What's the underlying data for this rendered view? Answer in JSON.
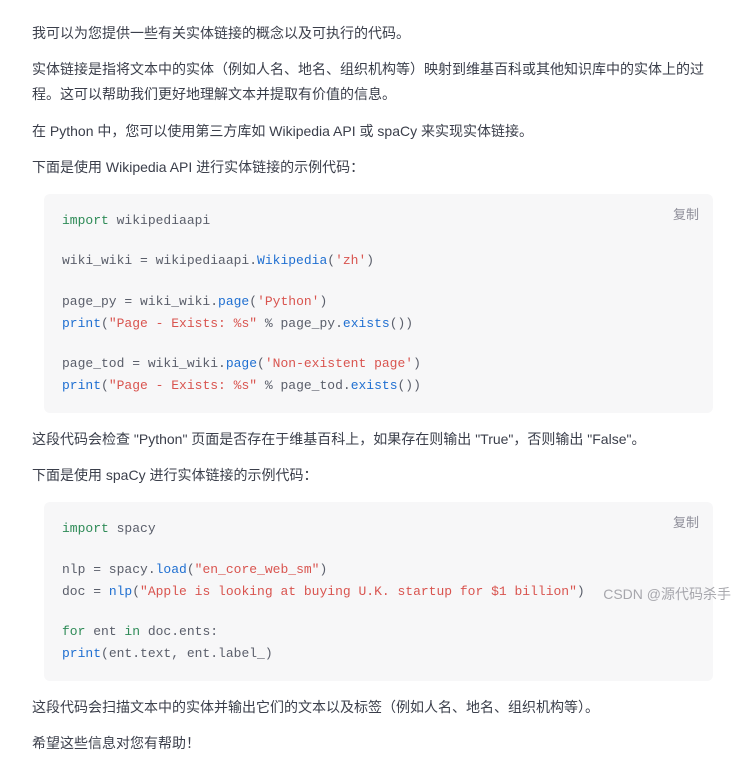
{
  "paragraphs": {
    "p1": "我可以为您提供一些有关实体链接的概念以及可执行的代码。",
    "p2": "实体链接是指将文本中的实体（例如人名、地名、组织机构等）映射到维基百科或其他知识库中的实体上的过程。这可以帮助我们更好地理解文本并提取有价值的信息。",
    "p3": "在 Python 中，您可以使用第三方库如 Wikipedia API 或 spaCy 来实现实体链接。",
    "p4": "下面是使用 Wikipedia API 进行实体链接的示例代码：",
    "p5": "这段代码会检查 \"Python\" 页面是否存在于维基百科上，如果存在则输出 \"True\"，否则输出 \"False\"。",
    "p6": "下面是使用 spaCy 进行实体链接的示例代码：",
    "p7": "这段代码会扫描文本中的实体并输出它们的文本以及标签（例如人名、地名、组织机构等）。",
    "p8": "希望这些信息对您有帮助！"
  },
  "copy_label": "复制",
  "code1": {
    "import_kw": "import",
    "module": " wikipediaapi",
    "l2_pre": "wiki_wiki = wikipediaapi.",
    "l2_fn": "Wikipedia",
    "l2_open": "(",
    "l2_str": "'zh'",
    "l2_close": ")",
    "l3_pre": "page_py = wiki_wiki.",
    "l3_fn": "page",
    "l3_open": "(",
    "l3_str": "'Python'",
    "l3_close": ")",
    "l4_fn": "print",
    "l4_open": "(",
    "l4_str": "\"Page - Exists: %s\"",
    "l4_mid": " % page_py.",
    "l4_fn2": "exists",
    "l4_close": "())",
    "l5_pre": "page_tod = wiki_wiki.",
    "l5_fn": "page",
    "l5_open": "(",
    "l5_str": "'Non-existent page'",
    "l5_close": ")",
    "l6_fn": "print",
    "l6_open": "(",
    "l6_str": "\"Page - Exists: %s\"",
    "l6_mid": " % page_tod.",
    "l6_fn2": "exists",
    "l6_close": "())"
  },
  "code2": {
    "import_kw": "import",
    "module": " spacy",
    "l2_pre": "nlp = spacy.",
    "l2_fn": "load",
    "l2_open": "(",
    "l2_str": "\"en_core_web_sm\"",
    "l2_close": ")",
    "l3_pre": "doc = ",
    "l3_fn": "nlp",
    "l3_open": "(",
    "l3_str": "\"Apple is looking at buying U.K. startup for $1 billion\"",
    "l3_close": ")",
    "l4_for": "for",
    "l4_mid1": " ent ",
    "l4_in": "in",
    "l4_mid2": " doc.ents:",
    "l5_indent": "    ",
    "l5_fn": "print",
    "l5_rest": "(ent.text, ent.label_)"
  },
  "watermark": "CSDN @源代码杀手"
}
